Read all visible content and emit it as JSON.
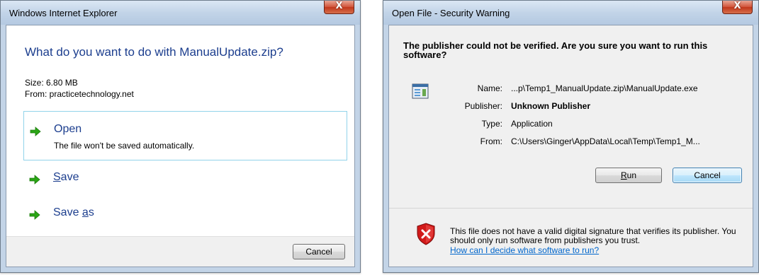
{
  "dialog1": {
    "title": "Windows Internet Explorer",
    "question": "What do you want to do with ManualUpdate.zip?",
    "size_line": "Size: 6.80 MB",
    "from_line": "From: practicetechnology.net",
    "options": [
      {
        "label_before": "Open",
        "label_ul": "",
        "label_after": "",
        "sublabel": "The file won't be saved automatically.",
        "selected": true
      },
      {
        "label_before": "",
        "label_ul": "S",
        "label_after": "ave",
        "sublabel": "",
        "selected": false
      },
      {
        "label_before": "Save ",
        "label_ul": "a",
        "label_after": "s",
        "sublabel": "",
        "selected": false
      }
    ],
    "cancel_label": "Cancel",
    "close_glyph": "X"
  },
  "dialog2": {
    "title": "Open File - Security Warning",
    "heading": "The publisher could not be verified.  Are you sure you want to run this software?",
    "fields": [
      {
        "label": "Name:",
        "value": "...p\\Temp1_ManualUpdate.zip\\ManualUpdate.exe",
        "bold": false
      },
      {
        "label": "Publisher:",
        "value": "Unknown Publisher",
        "bold": true
      },
      {
        "label": "Type:",
        "value": "Application",
        "bold": false
      },
      {
        "label": "From:",
        "value": "C:\\Users\\Ginger\\AppData\\Local\\Temp\\Temp1_M...",
        "bold": false
      }
    ],
    "run_ul": "R",
    "run_rest": "un",
    "cancel_label": "Cancel",
    "warning_text": "This file does not have a valid digital signature that verifies its publisher.  You should only run software from publishers you trust.",
    "help_link": "How can I decide what software to run?",
    "close_glyph": "X"
  },
  "colors": {
    "link_blue": "#0066cc",
    "heading_blue": "#1c3e8e",
    "arrow_green": "#2aa515",
    "shield_red": "#d11a1a",
    "close_red": "#c1371b"
  },
  "icons": [
    "green-arrow-icon",
    "application-icon",
    "shield-error-icon",
    "close-icon"
  ]
}
